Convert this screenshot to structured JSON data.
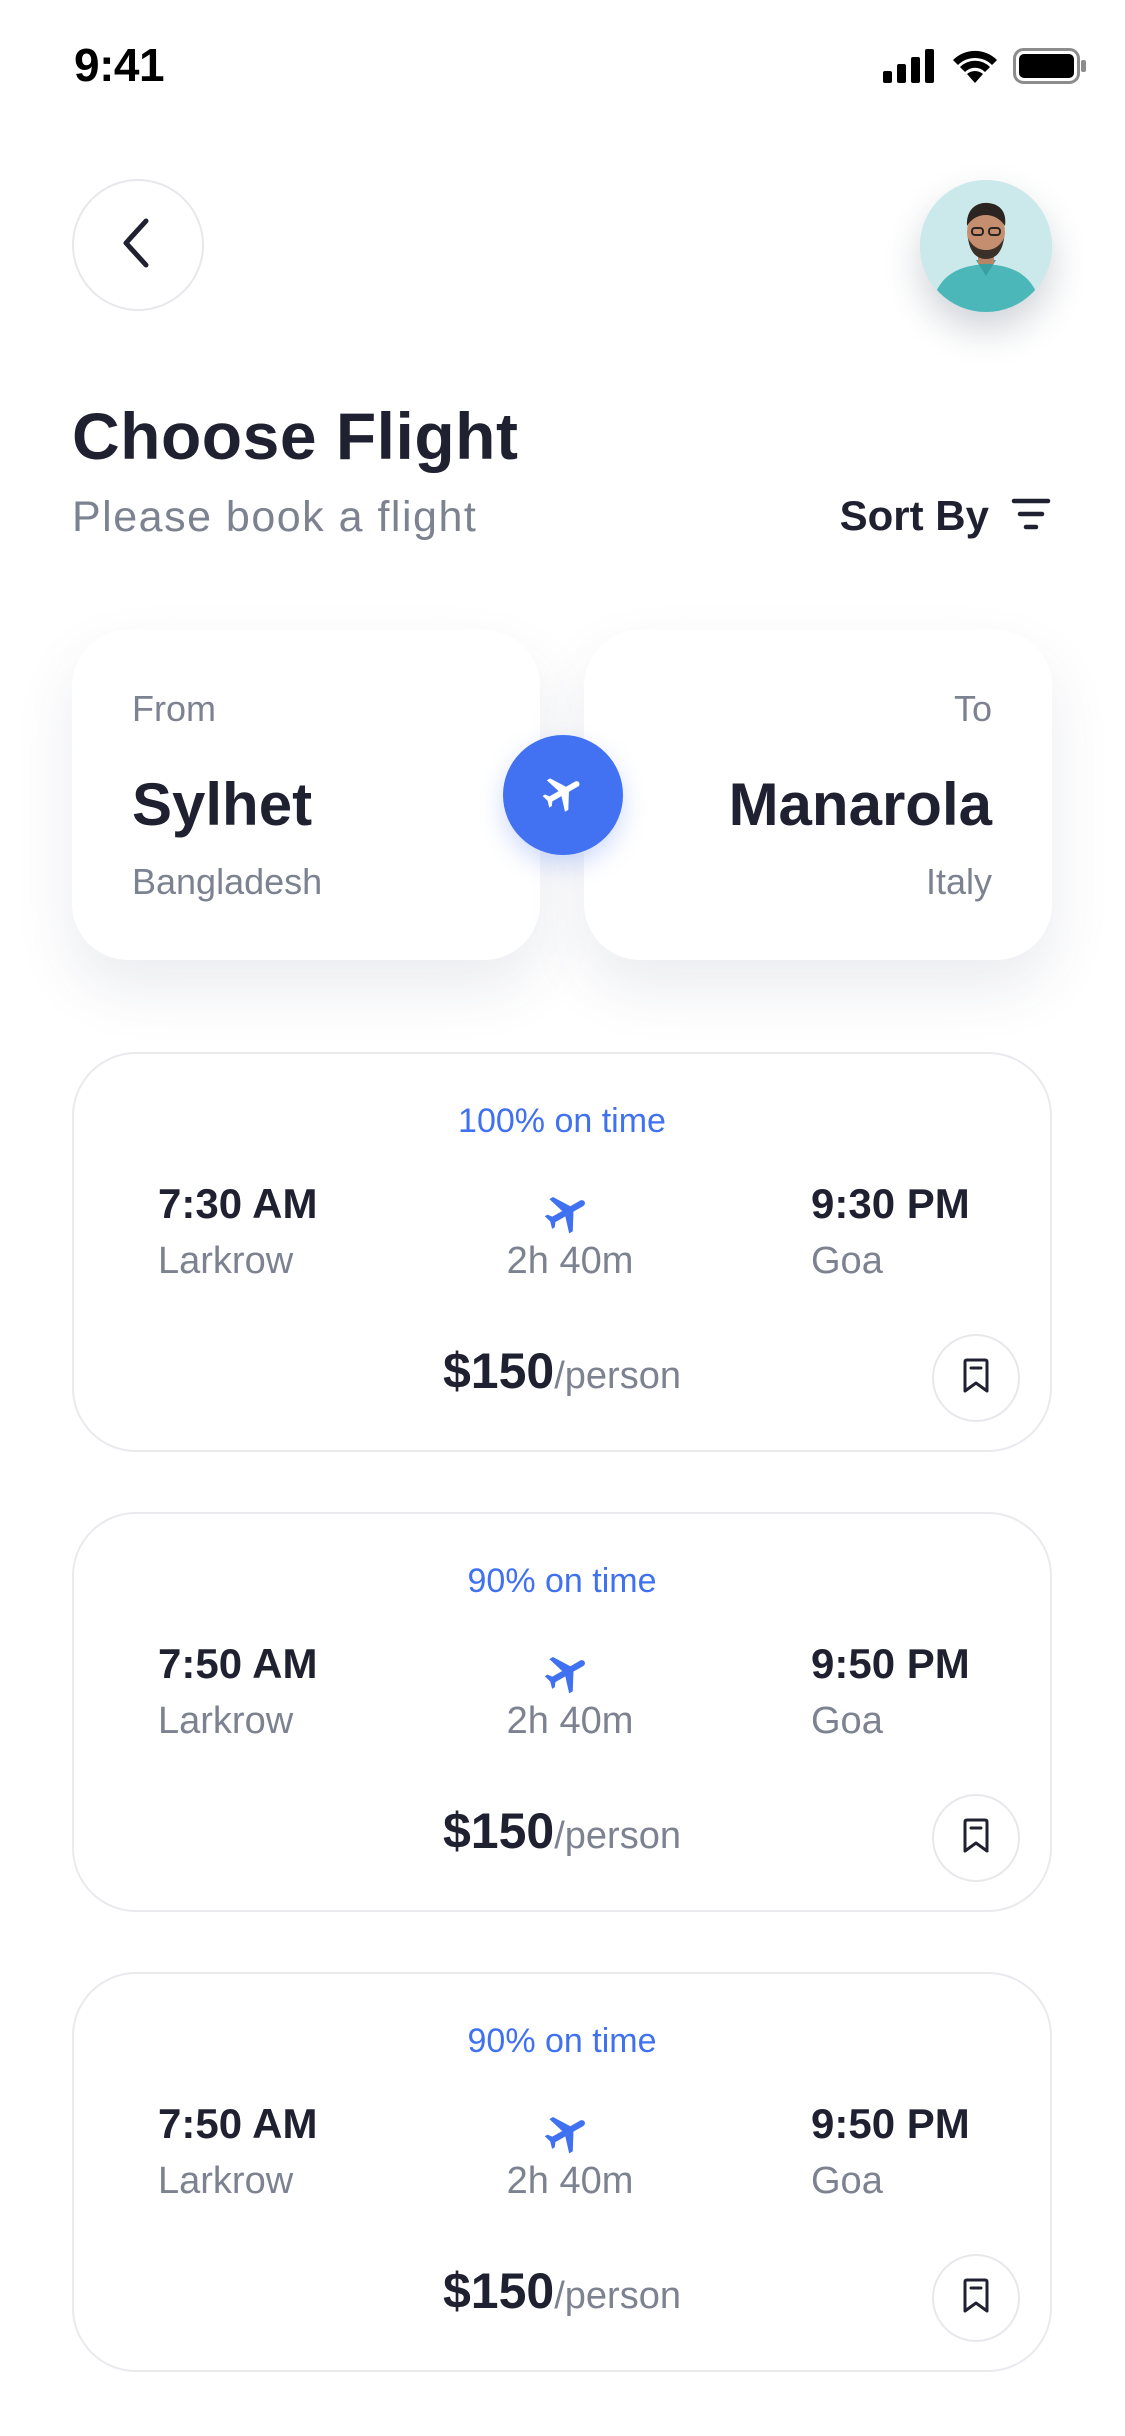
{
  "status_bar": {
    "time": "9:41"
  },
  "header": {
    "title": "Choose Flight",
    "subtitle": "Please book a flight",
    "sort_label": "Sort By"
  },
  "route": {
    "from": {
      "caption": "From",
      "city": "Sylhet",
      "country": "Bangladesh"
    },
    "to": {
      "caption": "To",
      "city": "Manarola",
      "country": "Italy"
    }
  },
  "flights": [
    {
      "on_time": "100% on time",
      "dep_time": "7:30 AM",
      "dep_city": "Larkrow",
      "duration": "2h 40m",
      "arr_time": "9:30 PM",
      "arr_city": "Goa",
      "price": "$150",
      "per": "/person"
    },
    {
      "on_time": "90% on time",
      "dep_time": "7:50 AM",
      "dep_city": "Larkrow",
      "duration": "2h 40m",
      "arr_time": "9:50 PM",
      "arr_city": "Goa",
      "price": "$150",
      "per": "/person"
    },
    {
      "on_time": "90% on time",
      "dep_time": "7:50 AM",
      "dep_city": "Larkrow",
      "duration": "2h 40m",
      "arr_time": "9:50 PM",
      "arr_city": "Goa",
      "price": "$150",
      "per": "/person"
    }
  ],
  "icons": {
    "back": "chevron-left-icon",
    "sort": "filter-lines-icon",
    "swap": "airplane-icon",
    "flight": "airplane-icon",
    "bookmark": "bookmark-icon",
    "signal": "cellular-signal-icon",
    "wifi": "wifi-icon",
    "battery": "battery-icon"
  },
  "colors": {
    "accent": "#4272f2",
    "on_time": "#3f71f0",
    "text_primary": "#1f2130",
    "text_secondary": "#7d8291"
  }
}
